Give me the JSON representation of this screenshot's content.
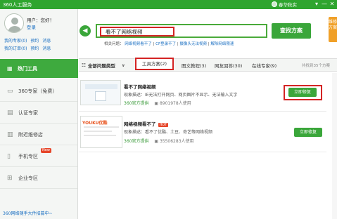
{
  "window": {
    "title": "360人工服务",
    "username_short": "春华秋实",
    "controls": [
      "▾",
      "—",
      "✕"
    ]
  },
  "user": {
    "name_line": "用户：您好！",
    "login": "登录",
    "links_row1": [
      "我的专家(0)",
      "预约",
      "消息"
    ],
    "links_row2": [
      "我的订单(0)",
      "预约",
      "消息"
    ]
  },
  "sidebar": {
    "active": {
      "label": "热门工具",
      "icon": "grid-icon"
    },
    "items": [
      {
        "label": "360专家（免费）",
        "icon": "chat-icon"
      },
      {
        "label": "认证专家",
        "icon": "user-icon"
      },
      {
        "label": "附近维修店",
        "icon": "shop-icon"
      },
      {
        "label": "手机专区",
        "icon": "phone-icon",
        "badge": "New"
      },
      {
        "label": "企业专区",
        "icon": "windows-icon"
      }
    ],
    "footer": "360网络随手大件招募中~"
  },
  "search": {
    "query": "看不了网络视频",
    "button": "查找方案",
    "side_tab": "维修方案",
    "related_label": "相关问题：",
    "related": [
      "网络视频看不了",
      "CF登录不了",
      "摄像头无法视频",
      "解除网络限速"
    ]
  },
  "tabs": {
    "all_types": "全部问题类型",
    "items": [
      "工具方案(2)",
      "图文教程(3)",
      "网友回答(30)",
      "在线专家(9)"
    ],
    "total": "共找到35个方案"
  },
  "results": [
    {
      "title": "看不了网络视频",
      "desc": "现象描述：IE无法打开网页、网页图片不显示、无法输入文字",
      "source": "360官方提供",
      "users": "8901978人使用",
      "button": "立即修复"
    },
    {
      "title": "网络视频看不了",
      "badge": "HOT",
      "thumb_logo": "YOUKU优酷",
      "desc": "现象描述：看不了优酷、土豆、奇艺等网络视频",
      "source": "360官方提供",
      "users": "35506283人使用",
      "button": "立即修复"
    }
  ],
  "colors": {
    "green": "#3aa63a",
    "highlight_red": "#d42424",
    "title_green": "#2fa52f",
    "link_blue": "#1a6fc2"
  }
}
